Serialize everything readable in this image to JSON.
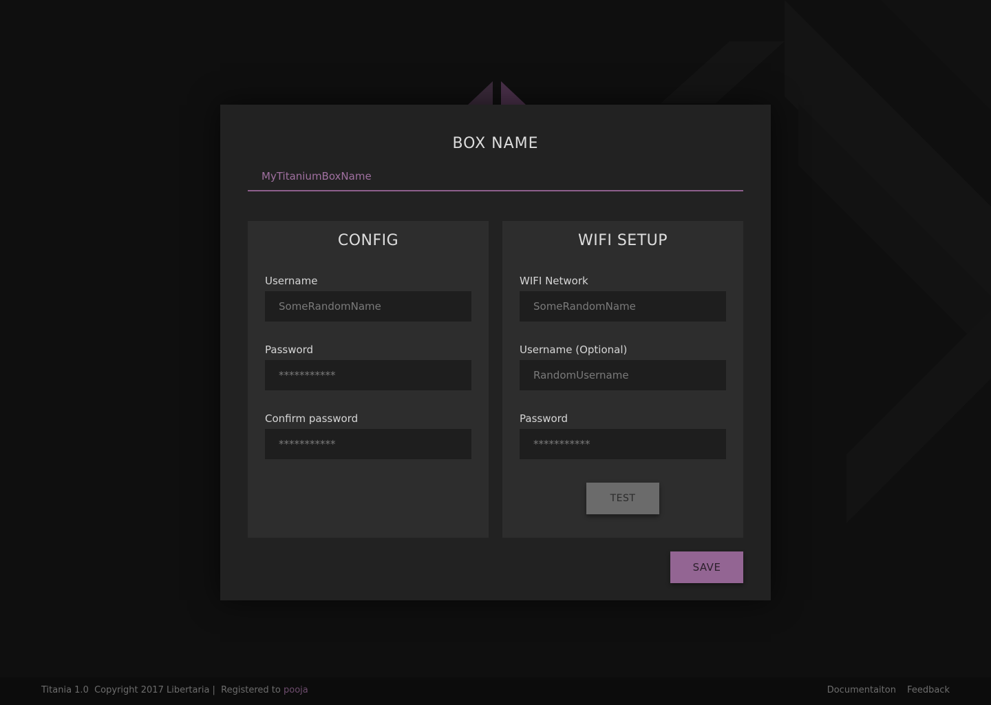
{
  "box": {
    "title": "BOX NAME",
    "name_value": "MyTitaniumBoxName"
  },
  "config": {
    "title": "CONFIG",
    "username_label": "Username",
    "username_value": "SomeRandomName",
    "password_label": "Password",
    "password_value": "***********",
    "confirm_label": "Confirm password",
    "confirm_value": "***********"
  },
  "wifi": {
    "title": "WIFI SETUP",
    "network_label": "WIFI Network",
    "network_value": "SomeRandomName",
    "username_label": "Username (Optional)",
    "username_value": "RandomUsername",
    "password_label": "Password",
    "password_value": "***********",
    "test_label": "TEST"
  },
  "actions": {
    "save_label": "SAVE"
  },
  "footer": {
    "app_info": "Titania 1.0  Copyright 2017 Libertaria |  Registered to ",
    "user": "pooja",
    "docs_link": "Documentaiton",
    "feedback_link": "Feedback"
  },
  "colors": {
    "accent": "#936593",
    "background": "#0f0f0f",
    "card": "#222222",
    "panel": "#2d2d2d"
  }
}
